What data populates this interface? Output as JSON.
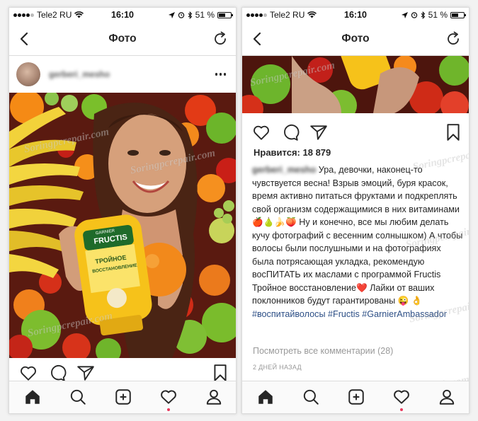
{
  "status_bar": {
    "carrier": "Tele2 RU",
    "time": "16:10",
    "battery": "51 %"
  },
  "header": {
    "title": "Фото"
  },
  "post": {
    "username": "gerberi_mesho",
    "likes": "Нравится: 18 879",
    "caption": {
      "author": "gerberi_mesho",
      "text1": " Ура, девочки, наконец-то чувствуется весна! Взрыв эмоций, буря красок, время активно питаться фруктами и подкреплять свой организм содержащимися в них витаминами🍎🍐🍌🍑 Ну и конечно, все мы любим делать кучу фотографий с весенним солнышком) А чтобы волосы были послушными и на фотографиях была потрясающая укладка, рекомендую восПИТАТЬ их маслами с программой Fructis Тройное восстановление❤️ Лайки от ваших поклонников будут гарантированы 😜 👌 ",
      "tag1": "#воспитайволосы",
      "tag2": "#Fructis",
      "tag3": "#GarnierAmbassador"
    },
    "comments_link": "Посмотреть все комментарии (28)",
    "time_ago": "2 ДНЕЙ НАЗАД"
  },
  "product": {
    "brand": "GARNIER",
    "name": "FRUCTIS",
    "line1": "ТРОЙНОЕ",
    "line2": "ВОССТАНОВЛЕНИЕ"
  },
  "watermark": "Soringpcrepair.com",
  "colors": {
    "hashtag": "#2d4f86",
    "notification_dot": "#e8375a",
    "bottle": "#f6c21a"
  },
  "icons": [
    "back-chevron-icon",
    "refresh-icon",
    "more-dots-icon",
    "heart-icon",
    "comment-icon",
    "share-icon",
    "bookmark-icon",
    "home-icon",
    "search-icon",
    "add-icon",
    "activity-heart-icon",
    "profile-icon"
  ]
}
